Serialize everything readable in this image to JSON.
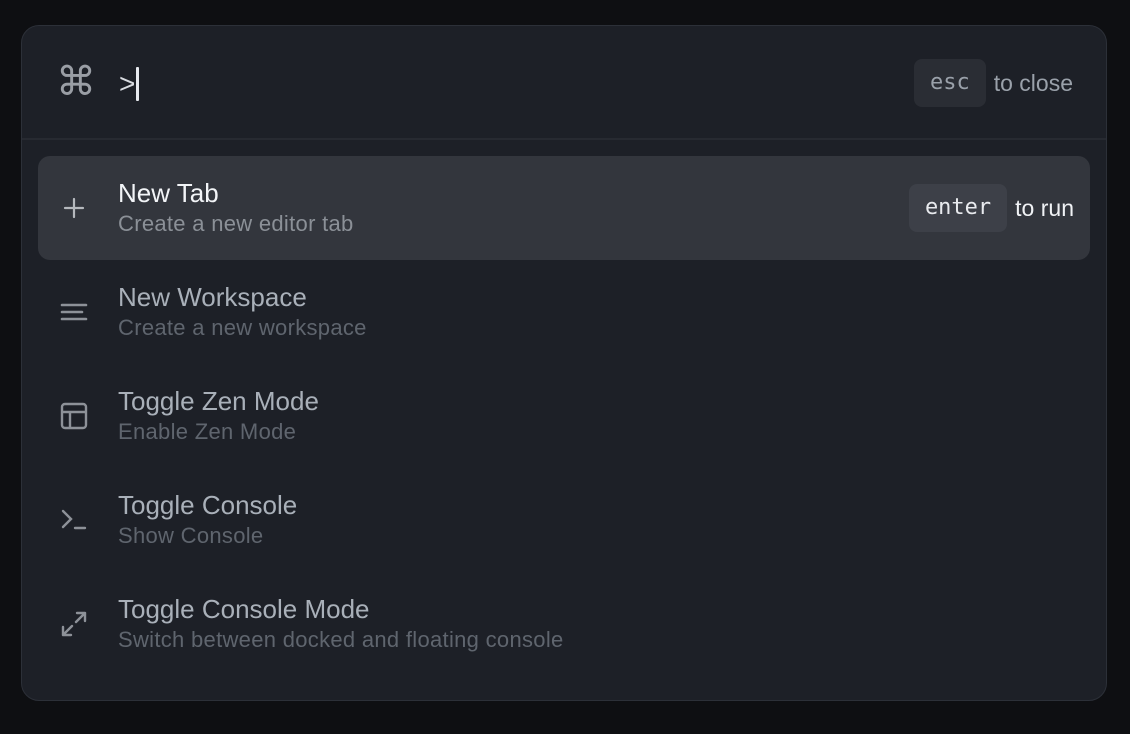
{
  "header": {
    "query": ">",
    "close_key": "esc",
    "close_hint": "to close"
  },
  "commands": [
    {
      "title": "New Tab",
      "subtitle": "Create a new editor tab",
      "icon": "plus-icon",
      "selected": true,
      "run_key": "enter",
      "run_hint": "to run"
    },
    {
      "title": "New Workspace",
      "subtitle": "Create a new workspace",
      "icon": "lines-icon"
    },
    {
      "title": "Toggle Zen Mode",
      "subtitle": "Enable Zen Mode",
      "icon": "layout-icon"
    },
    {
      "title": "Toggle Console",
      "subtitle": "Show Console",
      "icon": "terminal-icon"
    },
    {
      "title": "Toggle Console Mode",
      "subtitle": "Switch between docked and floating console",
      "icon": "expand-icon"
    }
  ]
}
